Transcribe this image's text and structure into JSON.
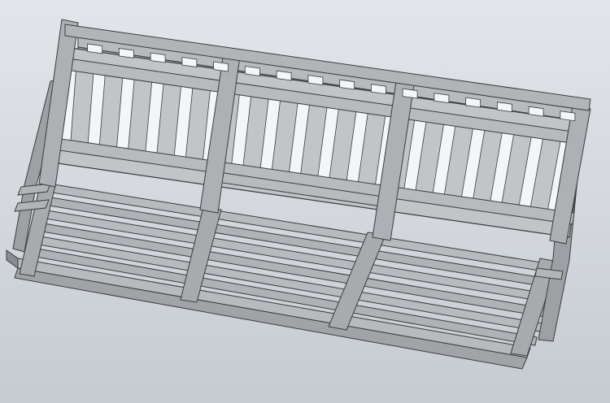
{
  "viewport": {
    "background_top": "#e2e5e9",
    "background_bottom": "#c6cbd2"
  },
  "model": {
    "face_light": "#b9babd",
    "face_mid": "#a1a3a6",
    "face_dark": "#8a8c8f",
    "edge_color": "#3b3c3e",
    "back_rail_count": 3,
    "back_slat_count": 18,
    "seat_slat_count": 6,
    "seat_support_count": 3
  }
}
